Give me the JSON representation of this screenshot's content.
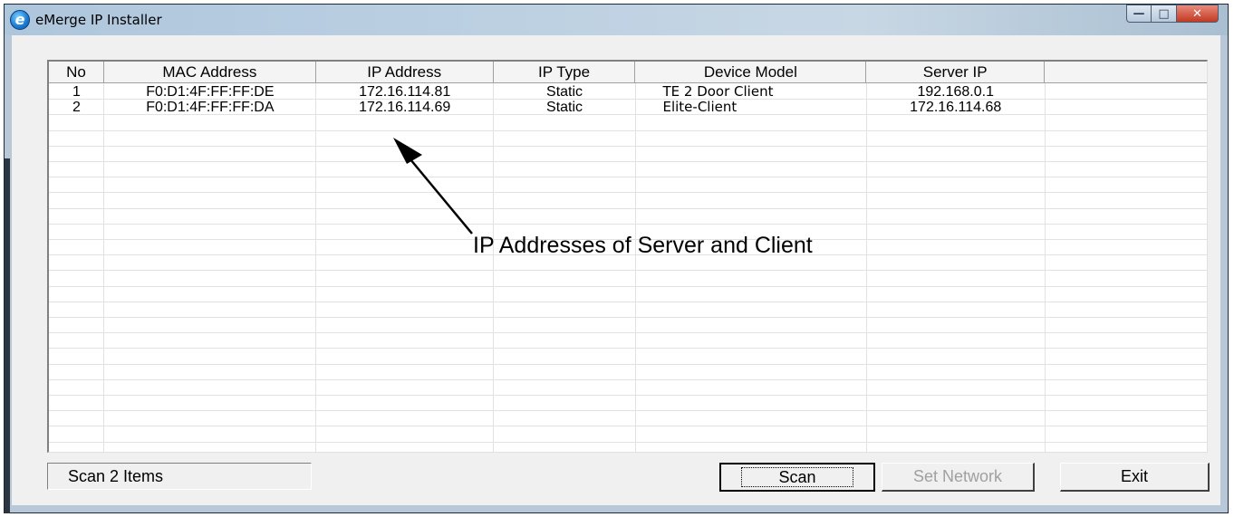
{
  "window": {
    "title": "eMerge IP Installer",
    "icon": "app-e-icon"
  },
  "table": {
    "columns": [
      "No",
      "MAC Address",
      "IP Address",
      "IP Type",
      "Device Model",
      "Server IP",
      ""
    ],
    "rows": [
      [
        "1",
        "F0:D1:4F:FF:FF:DE",
        "172.16.114.81",
        "Static",
        "TE 2 Door Client",
        "192.168.0.1",
        ""
      ],
      [
        "2",
        "F0:D1:4F:FF:FF:DA",
        "172.16.114.69",
        "Static",
        "Elite-Client",
        "172.16.114.68",
        ""
      ]
    ]
  },
  "annotation": {
    "text": "IP Addresses of Server and Client"
  },
  "status": {
    "text": "Scan 2 Items"
  },
  "buttons": {
    "scan": "Scan",
    "set_network": "Set Network",
    "exit": "Exit"
  },
  "colors": {
    "accent": "#1e7fd6",
    "disabled_text": "#a0a0a0"
  }
}
